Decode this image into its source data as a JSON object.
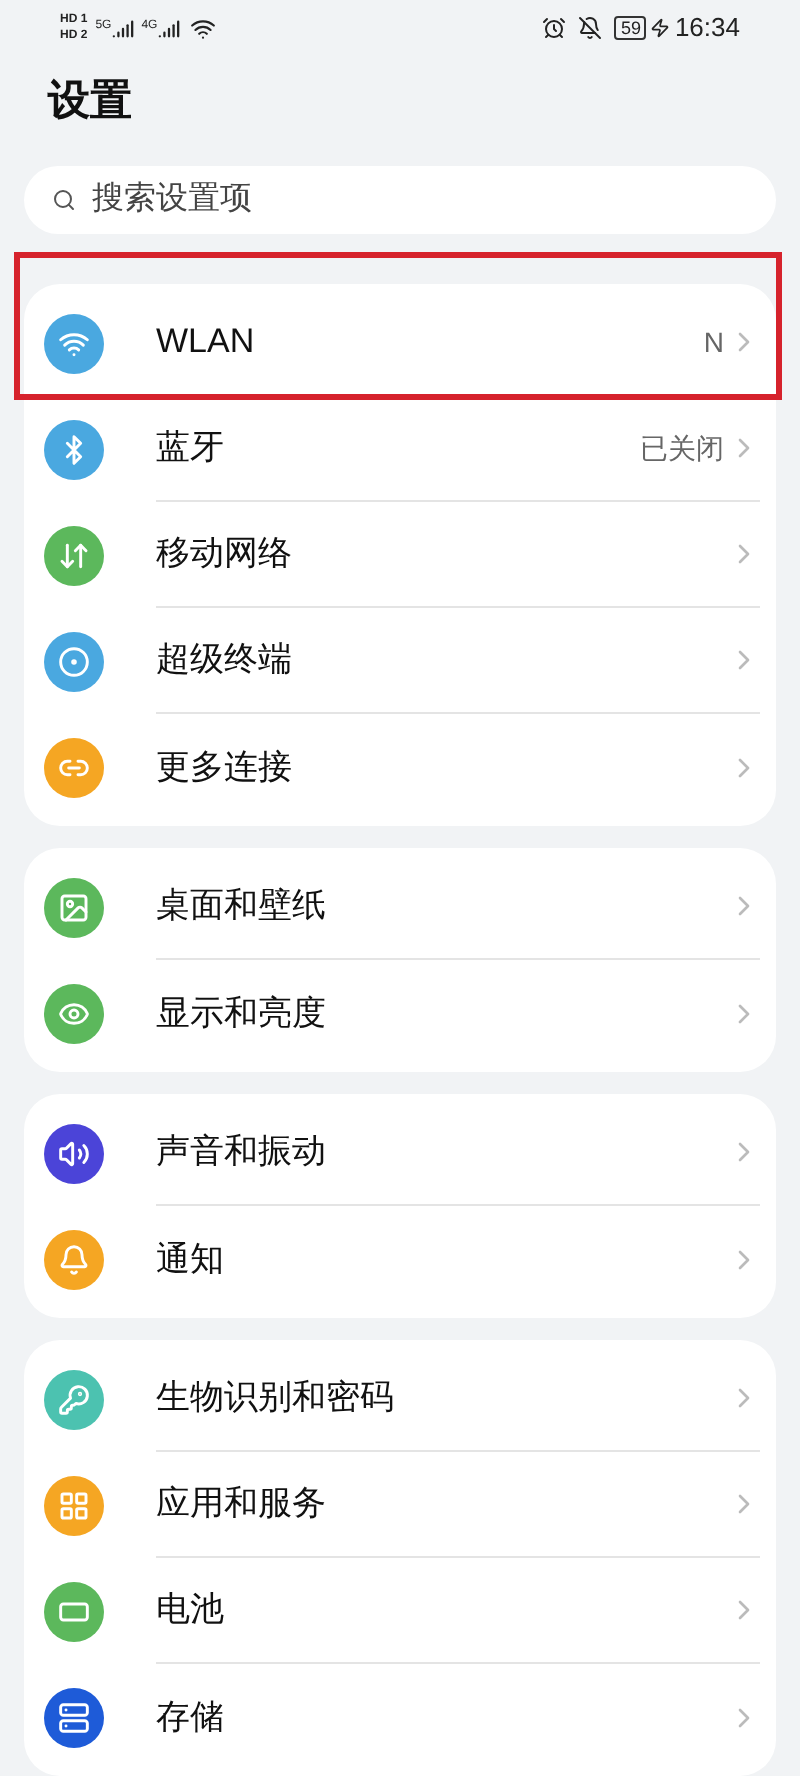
{
  "status_bar": {
    "sims": [
      {
        "label": "HD",
        "slot": "1"
      },
      {
        "label": "HD",
        "slot": "2"
      }
    ],
    "networks": [
      "5G",
      "4G"
    ],
    "battery": "59",
    "charging": true,
    "time": "16:34"
  },
  "title": "设置",
  "search": {
    "placeholder": "搜索设置项"
  },
  "groups": [
    {
      "items": [
        {
          "label": "WLAN",
          "value": "N",
          "color": "#4aa8e0",
          "highlighted": true
        },
        {
          "label": "蓝牙",
          "value": "已关闭",
          "color": "#4aa8e0",
          "highlighted": false
        },
        {
          "label": "移动网络",
          "color": "#5cb85c",
          "highlighted": false
        },
        {
          "label": "超级终端",
          "color": "#4aa8e0",
          "highlighted": false
        },
        {
          "label": "更多连接",
          "color": "#f5a623",
          "highlighted": false
        }
      ]
    },
    {
      "items": [
        {
          "label": "桌面和壁纸",
          "color": "#5cb85c",
          "highlighted": false
        },
        {
          "label": "显示和亮度",
          "color": "#5cb85c",
          "highlighted": false
        }
      ]
    },
    {
      "items": [
        {
          "label": "声音和振动",
          "color": "#4b44d8",
          "highlighted": false
        },
        {
          "label": "通知",
          "color": "#f5a623",
          "highlighted": false
        }
      ]
    },
    {
      "items": [
        {
          "label": "生物识别和密码",
          "color": "#4cc2b0",
          "highlighted": false
        },
        {
          "label": "应用和服务",
          "color": "#f5a623",
          "highlighted": false
        },
        {
          "label": "电池",
          "color": "#5cb85c",
          "highlighted": false
        },
        {
          "label": "存储",
          "color": "#1e5bd8",
          "highlighted": false
        }
      ]
    }
  ]
}
